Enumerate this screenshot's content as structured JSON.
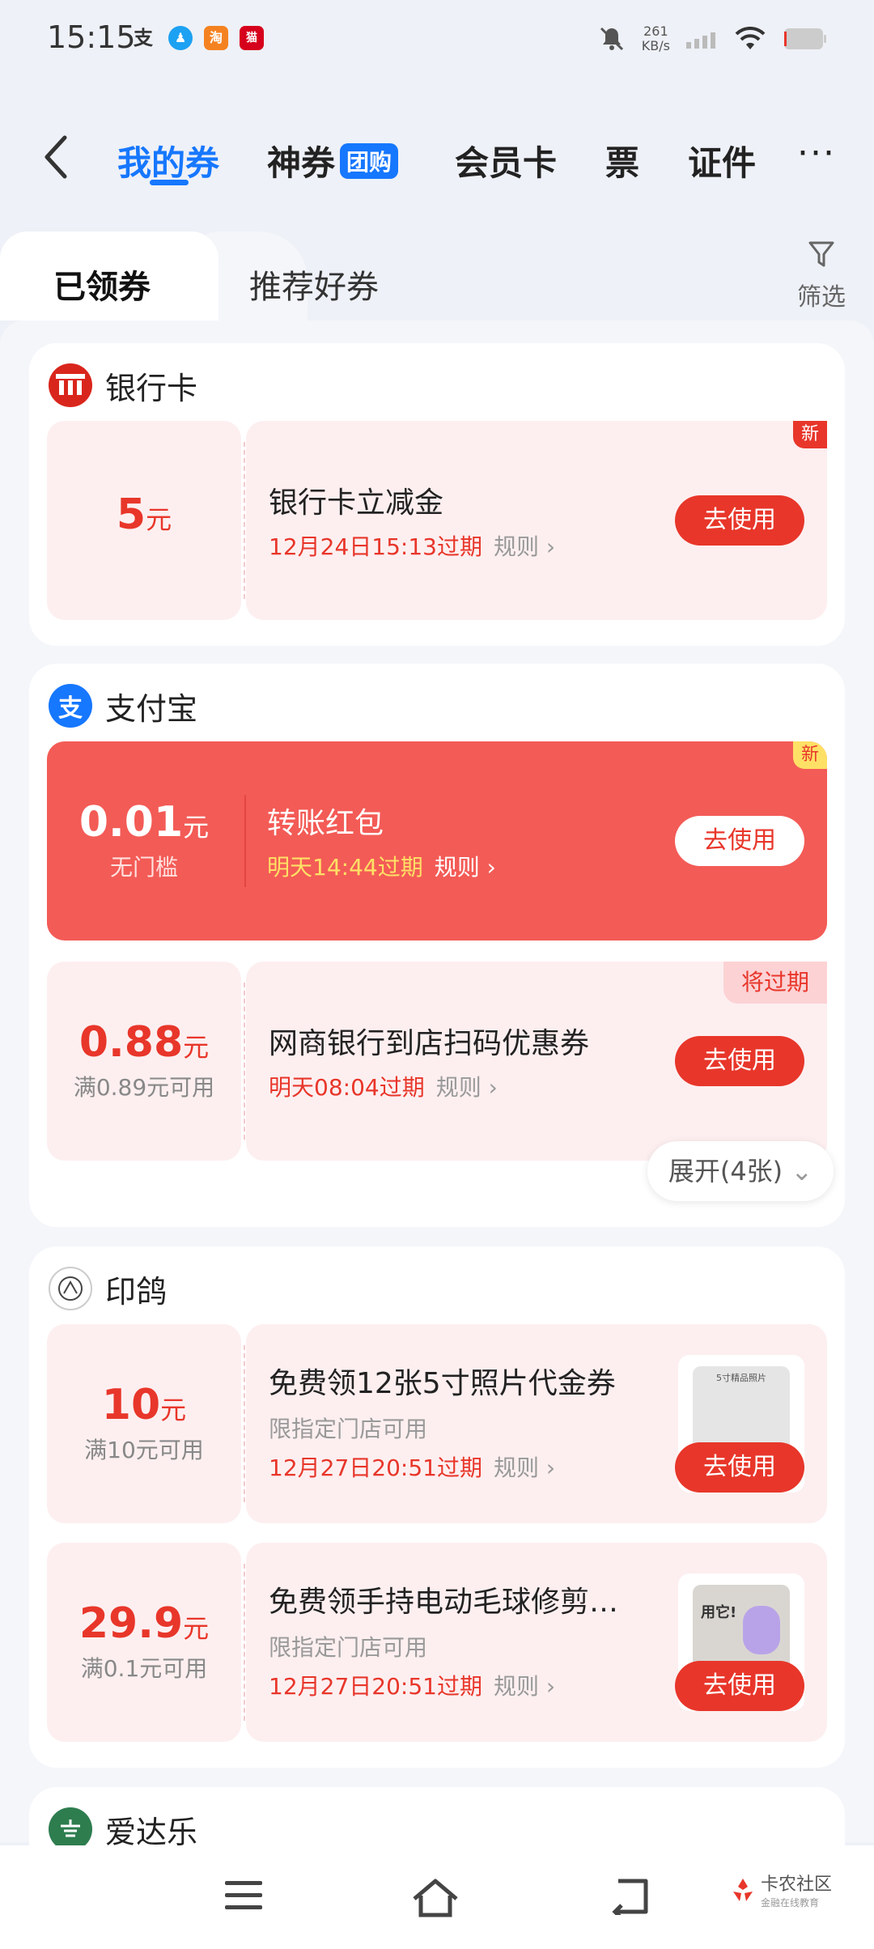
{
  "status_bar": {
    "time": "15:15",
    "speed": "261",
    "speed_unit": "KB/s"
  },
  "nav": {
    "tabs": [
      "我的券",
      "神券",
      "会员卡",
      "票",
      "证件"
    ],
    "tuan_badge": "团购",
    "more": "···"
  },
  "subtabs": {
    "active": "已领券",
    "other": "推荐好券"
  },
  "filter_label": "筛选",
  "sections": {
    "bank": {
      "name": "银行卡",
      "coupon": {
        "amount": "5",
        "unit": "元",
        "title": "银行卡立减金",
        "expiry": "12月24日15:13过期",
        "rule": "规则",
        "btn": "去使用",
        "badge": "新"
      }
    },
    "alipay": {
      "name": "支付宝",
      "logo_char": "支",
      "coupon1": {
        "amount": "0.01",
        "unit": "元",
        "cond": "无门槛",
        "title": "转账红包",
        "expiry": "明天14:44过期",
        "rule": "规则",
        "btn": "去使用",
        "badge": "新"
      },
      "coupon2": {
        "amount": "0.88",
        "unit": "元",
        "cond": "满0.89元可用",
        "title": "网商银行到店扫码优惠券",
        "expiry": "明天08:04过期",
        "rule": "规则",
        "btn": "去使用",
        "badge": "将过期"
      },
      "expand": "展开(4张)"
    },
    "yinge": {
      "name": "印鸽",
      "coupon1": {
        "amount": "10",
        "unit": "元",
        "cond": "满10元可用",
        "title": "免费领12张5寸照片代金券",
        "scope": "限指定门店可用",
        "expiry": "12月27日20:51过期",
        "rule": "规则",
        "btn": "去使用",
        "thumb_text": "5寸精品照片"
      },
      "coupon2": {
        "amount": "29.9",
        "unit": "元",
        "cond": "满0.1元可用",
        "title": "免费领手持电动毛球修剪…",
        "scope": "限指定门店可用",
        "expiry": "12月27日20:51过期",
        "rule": "规则",
        "btn": "去使用",
        "thumb_text": "用它!"
      }
    },
    "aidale": {
      "name": "爱达乐"
    }
  },
  "watermark": {
    "name": "卡农社区",
    "sub": "金融在线教育"
  },
  "colors": {
    "accent": "#1677ff",
    "red": "#e8362a",
    "coupon_bg": "#fdeff0",
    "red_card": "#f35b56"
  }
}
